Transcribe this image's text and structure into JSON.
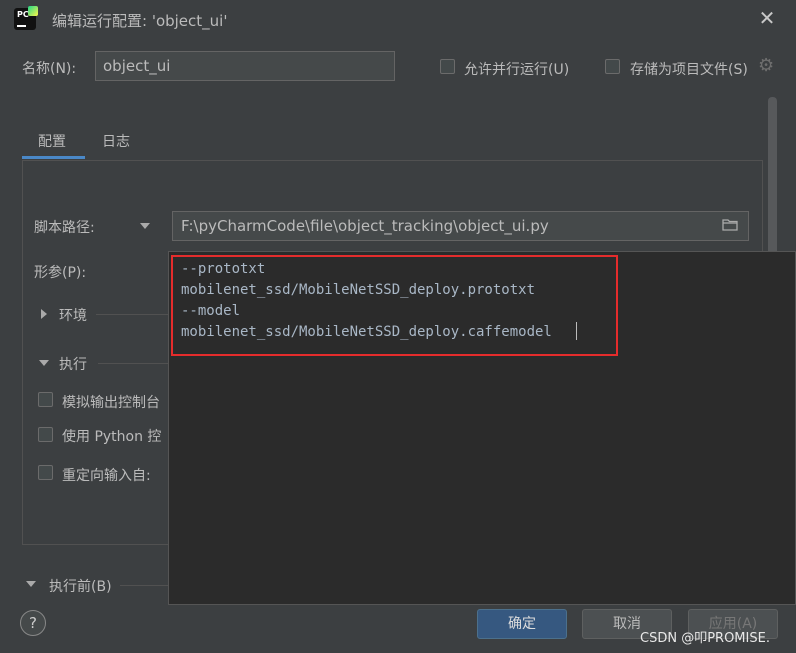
{
  "window": {
    "title": "编辑运行配置: 'object_ui'"
  },
  "name_row": {
    "label": "名称(N):",
    "value": "object_ui",
    "allow_parallel_label": "允许并行运行(U)",
    "store_as_project_label": "存储为项目文件(S)"
  },
  "tabs": [
    {
      "label": "配置",
      "active": true
    },
    {
      "label": "日志",
      "active": false
    }
  ],
  "config": {
    "script_path_label": "脚本路径:",
    "script_path_value": "F:\\pyCharmCode\\file\\object_tracking\\object_ui.py",
    "params_label": "形参(P):",
    "env_label": "环境",
    "exec_label": "执行",
    "emulate_console_label": "模拟输出控制台",
    "python_console_label": "使用 Python 控",
    "redirect_input_label": "重定向输入自:",
    "before_launch_label": "执行前(B)"
  },
  "params_editor": {
    "lines": [
      "--prototxt",
      "mobilenet_ssd/MobileNetSSD_deploy.prototxt",
      "--model",
      "mobilenet_ssd/MobileNetSSD_deploy.caffemodel"
    ]
  },
  "footer": {
    "help": "?",
    "ok": "确定",
    "cancel": "取消",
    "apply": "应用(A)",
    "watermark": "CSDN @叩PROMISE."
  },
  "colors": {
    "accent": "#4a88c7",
    "highlight_border": "#e52c2c",
    "primary_button": "#365880"
  },
  "icons": {
    "app": "pycharm-logo-icon",
    "close": "close-icon",
    "settings": "gear-icon",
    "folder": "folder-icon"
  }
}
